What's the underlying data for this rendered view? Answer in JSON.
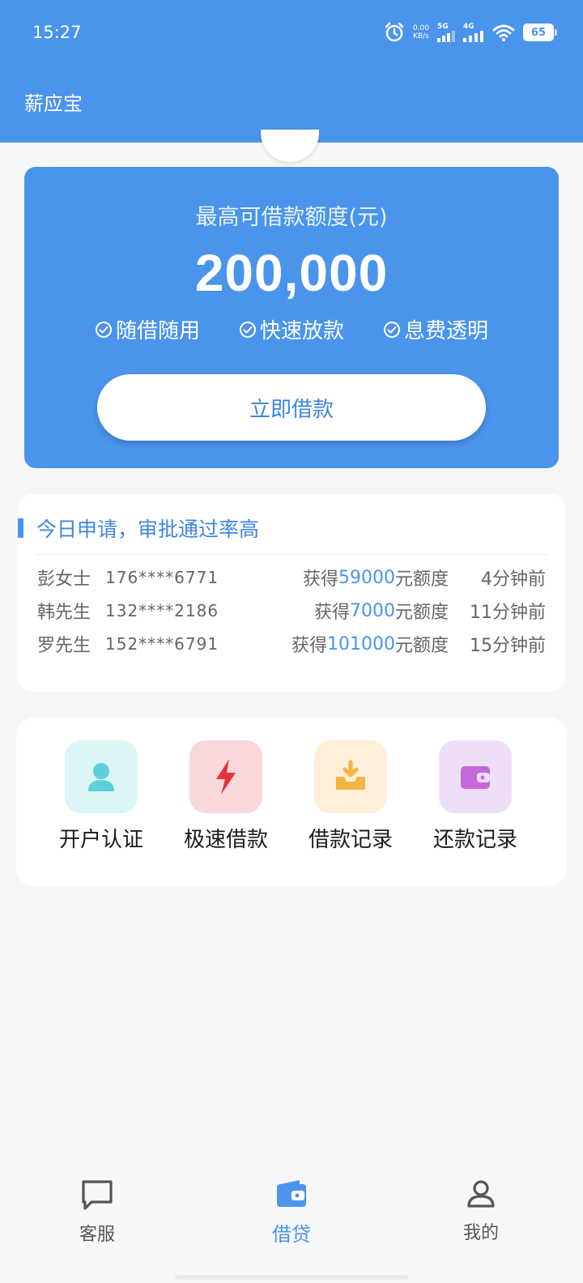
{
  "status_bar": {
    "time": "15:27",
    "net_speed_value": "0.00",
    "net_speed_unit": "KB/s",
    "net_5g": "5G",
    "net_4g": "4G",
    "battery": "65"
  },
  "app": {
    "title": "薪应宝"
  },
  "hero": {
    "label": "最高可借款额度(元)",
    "amount": "200,000",
    "features": [
      "随借随用",
      "快速放款",
      "息费透明"
    ],
    "button_label": "立即借款"
  },
  "approvals": {
    "title": "今日申请，审批通过率高",
    "rows": [
      {
        "name": "彭女士",
        "phone": "176****6771",
        "prefix": "获得",
        "amount": "59000",
        "suffix": "元额度",
        "ago": "4分钟前"
      },
      {
        "name": "韩先生",
        "phone": "132****2186",
        "prefix": "获得",
        "amount": "7000",
        "suffix": "元额度",
        "ago": "11分钟前"
      },
      {
        "name": "罗先生",
        "phone": "152****6791",
        "prefix": "获得",
        "amount": "101000",
        "suffix": "元额度",
        "ago": "15分钟前"
      }
    ]
  },
  "actions": [
    {
      "label": "开户认证",
      "icon": "user-icon",
      "tile_color": "#dcf6f8",
      "icon_color": "#5ecfd8"
    },
    {
      "label": "极速借款",
      "icon": "lightning-icon",
      "tile_color": "#f9d8dc",
      "icon_color": "#e53436"
    },
    {
      "label": "借款记录",
      "icon": "inbox-download-icon",
      "tile_color": "#fdefd9",
      "icon_color": "#f5b542"
    },
    {
      "label": "还款记录",
      "icon": "wallet-icon",
      "tile_color": "#efdff6",
      "icon_color": "#c46ad8"
    }
  ],
  "bottom_nav": [
    {
      "label": "客服",
      "icon": "chat-icon",
      "active": false
    },
    {
      "label": "借贷",
      "icon": "wallet-icon",
      "active": true
    },
    {
      "label": "我的",
      "icon": "person-icon",
      "active": false
    }
  ],
  "colors": {
    "primary": "#4a94ec",
    "accent_text": "#3d86e0",
    "background": "#f6f7f9"
  }
}
